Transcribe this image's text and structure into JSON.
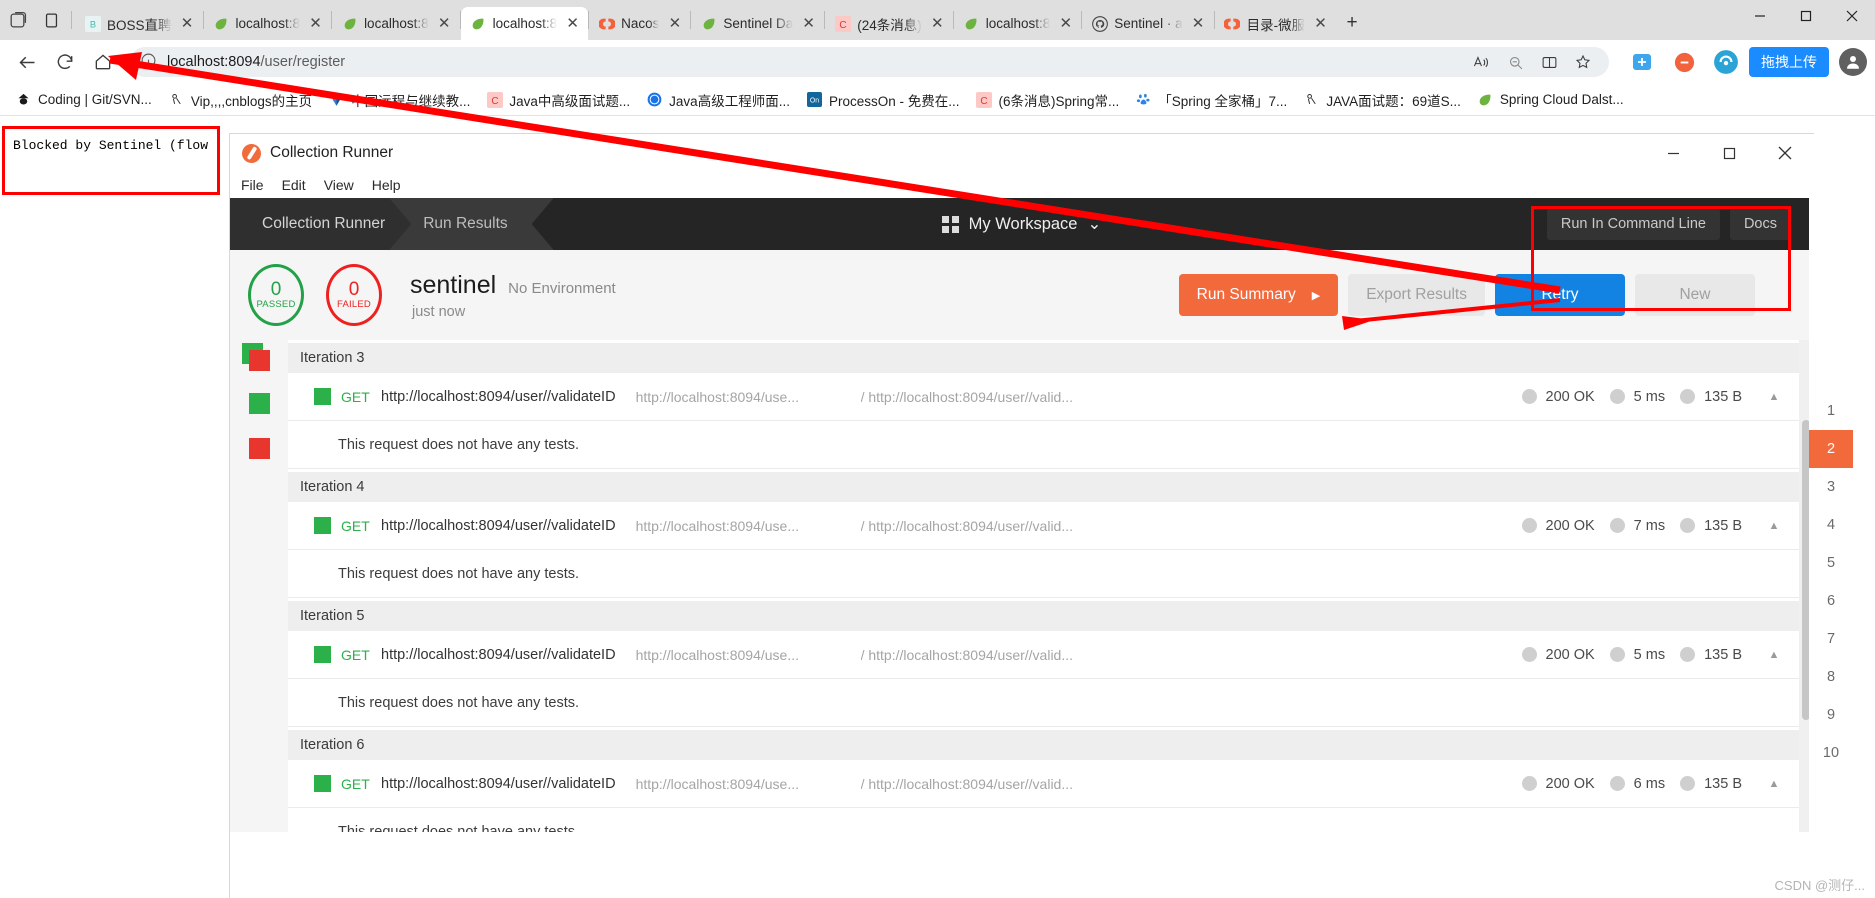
{
  "browser": {
    "tabstrip_icons": [
      "tab-search-icon",
      "tab-list-icon"
    ],
    "tabs": [
      {
        "label": "BOSS直聘",
        "favicon": "boss-icon",
        "active": false
      },
      {
        "label": "localhost:8",
        "favicon": "spring-leaf-icon",
        "active": false
      },
      {
        "label": "localhost:8",
        "favicon": "spring-leaf-icon",
        "active": false
      },
      {
        "label": "localhost:8",
        "favicon": "spring-leaf-icon",
        "active": true
      },
      {
        "label": "Nacos",
        "favicon": "nacos-icon",
        "active": false
      },
      {
        "label": "Sentinel Da",
        "favicon": "spring-leaf-icon",
        "active": false
      },
      {
        "label": "(24条消息)",
        "favicon": "csdn-icon",
        "active": false
      },
      {
        "label": "localhost:8",
        "favicon": "spring-leaf-icon",
        "active": false
      },
      {
        "label": "Sentinel · a",
        "favicon": "github-icon",
        "active": false
      },
      {
        "label": "目录-微服",
        "favicon": "nacos-icon",
        "active": false
      }
    ],
    "new_tab_label": "+",
    "window_buttons": [
      "minimize",
      "maximize",
      "close"
    ],
    "nav": {
      "back_icon": "back-arrow-icon",
      "reload_icon": "reload-icon",
      "home_icon": "home-icon",
      "info_icon": "info-circle-icon",
      "url_host": "localhost:8094",
      "url_path": "/user/register",
      "read_aloud_icon": "read-aloud-icon",
      "zoom_icon": "zoom-out-icon",
      "split_icon": "split-screen-icon",
      "favorite_icon": "favorites-star-icon",
      "collections_icon": "collections-icon",
      "extension_icon": "extension-icon",
      "upload_button_label": "拖拽上传",
      "profile_icon": "profile-avatar-icon"
    },
    "bookmarks": [
      {
        "label": "Coding | Git/SVN...",
        "icon": "coding-icon"
      },
      {
        "label": "Vip,,,,cnblogs的主页",
        "icon": "cnblogs-icon"
      },
      {
        "label": "中国远程与继续教...",
        "icon": "diamond-icon"
      },
      {
        "label": "Java中高级面试题...",
        "icon": "csdn-icon"
      },
      {
        "label": "Java高级工程师面...",
        "icon": "blue-circle-icon"
      },
      {
        "label": "ProcessOn - 免费在...",
        "icon": "processon-icon"
      },
      {
        "label": "(6条消息)Spring常...",
        "icon": "csdn-icon"
      },
      {
        "label": "「Spring 全家桶」7...",
        "icon": "baidu-icon"
      },
      {
        "label": "JAVA面试题：69道S...",
        "icon": "cnblogs-icon"
      },
      {
        "label": "Spring Cloud Dalst...",
        "icon": "spring-leaf-icon"
      }
    ]
  },
  "blocked_notice": {
    "text": "Blocked by Sentinel (flow limiti"
  },
  "postman": {
    "window_title": "Collection Runner",
    "menu": [
      "File",
      "Edit",
      "View",
      "Help"
    ],
    "nav": {
      "tab_collection_runner": "Collection Runner",
      "tab_run_results": "Run Results",
      "workspace": "My Workspace",
      "workspace_caret": "⌄",
      "run_in_command_line": "Run In Command Line",
      "docs": "Docs"
    },
    "summary": {
      "passed_count": "0",
      "passed_label": "PASSED",
      "failed_count": "0",
      "failed_label": "FAILED",
      "run_name": "sentinel",
      "environment": "No Environment",
      "time_ago": "just now"
    },
    "actions": {
      "run_summary": "Run Summary",
      "run_summary_caret": "▶",
      "export_results": "Export Results",
      "retry": "Retry",
      "new": "New"
    },
    "colors": {
      "orange": "#f2693c",
      "blue": "#1283e2",
      "green": "#2bb04a",
      "red": "#e8352d",
      "nav_dark": "#252525"
    },
    "results": [
      {
        "iteration": "Iteration 3",
        "method": "GET",
        "name": "http://localhost:8094/user//validateID",
        "url_short": "http://localhost:8094/use...",
        "url_full": "/ http://localhost:8094/user//valid...",
        "status": "200 OK",
        "time": "5 ms",
        "size": "135 B",
        "test_note": "This request does not have any tests.",
        "caret": "▲"
      },
      {
        "iteration": "Iteration 4",
        "method": "GET",
        "name": "http://localhost:8094/user//validateID",
        "url_short": "http://localhost:8094/use...",
        "url_full": "/ http://localhost:8094/user//valid...",
        "status": "200 OK",
        "time": "7 ms",
        "size": "135 B",
        "test_note": "This request does not have any tests.",
        "caret": "▲"
      },
      {
        "iteration": "Iteration 5",
        "method": "GET",
        "name": "http://localhost:8094/user//validateID",
        "url_short": "http://localhost:8094/use...",
        "url_full": "/ http://localhost:8094/user//valid...",
        "status": "200 OK",
        "time": "5 ms",
        "size": "135 B",
        "test_note": "This request does not have any tests.",
        "caret": "▲"
      },
      {
        "iteration": "Iteration 6",
        "method": "GET",
        "name": "http://localhost:8094/user//validateID",
        "url_short": "http://localhost:8094/use...",
        "url_full": "/ http://localhost:8094/user//valid...",
        "status": "200 OK",
        "time": "6 ms",
        "size": "135 B",
        "test_note": "This request does not have any tests.",
        "caret": "▲"
      }
    ],
    "pager": {
      "items": [
        "1",
        "2",
        "3",
        "4",
        "5",
        "6",
        "7",
        "8",
        "9",
        "10"
      ],
      "selected": "2"
    }
  },
  "watermark": "CSDN @测仔..."
}
